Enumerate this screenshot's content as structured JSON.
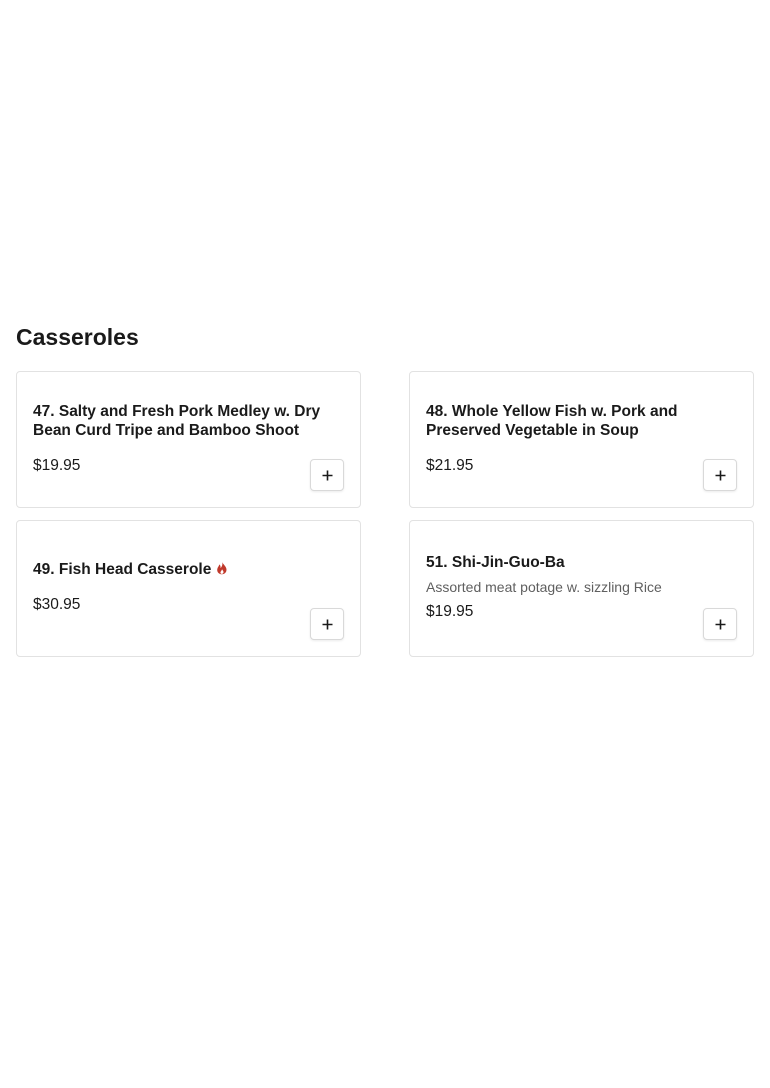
{
  "section": {
    "title": "Casseroles"
  },
  "items": [
    {
      "name": "47. Salty and Fresh Pork Medley w. Dry Bean Curd Tripe and Bamboo Shoot",
      "price": "$19.95"
    },
    {
      "name": "48. Whole Yellow Fish w. Pork and Preserved Vegetable in Soup",
      "price": "$21.95"
    },
    {
      "name": "49. Fish Head Casserole",
      "price": "$30.95",
      "icon": "spicy-flame-icon"
    },
    {
      "name": "51. Shi-Jin-Guo-Ba",
      "description": "Assorted meat potage w. sizzling Rice",
      "price": "$19.95"
    }
  ],
  "icons": {
    "add": "plus-icon",
    "spicy": "spicy-flame-icon"
  },
  "colors": {
    "spicy": "#c0392b",
    "card_border": "#e2e2e2",
    "text": "#1a1a1a",
    "muted_text": "#5f5f5f"
  }
}
